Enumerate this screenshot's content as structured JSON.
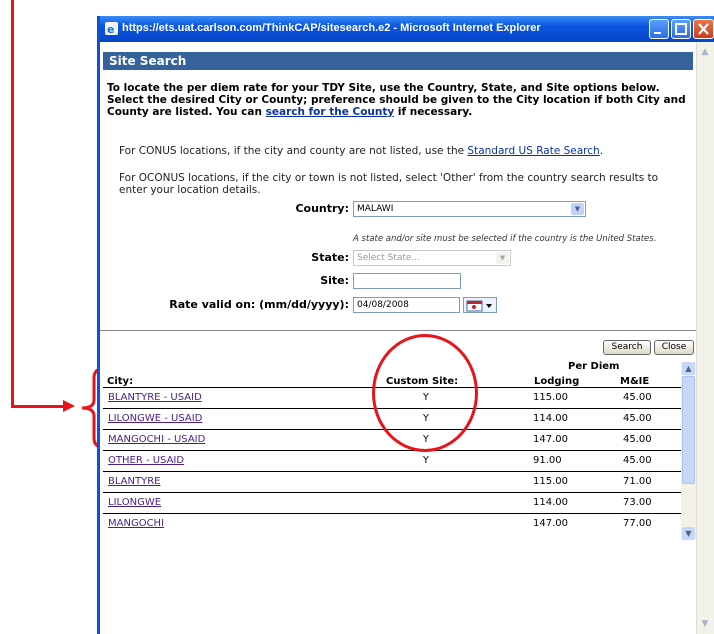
{
  "window": {
    "title": "https://ets.uat.carlson.com/ThinkCAP/sitesearch.e2 - Microsoft Internet Explorer"
  },
  "page": {
    "header": "Site Search",
    "intro": {
      "text_before_link": "To locate the per diem rate for your TDY Site, use the Country, State, and Site options below. Select the desired City or County; preference should be given to the City location if both City and County are listed. You can ",
      "link": "search for the County",
      "text_after_link": " if necessary."
    },
    "conus_note": {
      "text_before_link": "For CONUS locations, if the city and county are not listed, use the ",
      "link": "Standard US Rate Search",
      "text_after_link": "."
    },
    "oconus_note": "For OCONUS locations, if the city or town is not listed, select 'Other' from the country search results to enter your location details.",
    "form": {
      "country_label": "Country:",
      "country_value": "MALAWI",
      "country_hint": "A state and/or site must be selected if the country is the United States.",
      "state_label": "State:",
      "state_placeholder": "Select State...",
      "site_label": "Site:",
      "site_value": "",
      "date_label": "Rate valid on: (mm/dd/yyyy):",
      "date_value": "04/08/2008"
    },
    "buttons": {
      "search": "Search",
      "close": "Close"
    },
    "table": {
      "group_header": "Per Diem",
      "headers": {
        "city": "City:",
        "custom": "Custom Site:",
        "lodging": "Lodging",
        "mie": "M&IE"
      },
      "rows": [
        {
          "city": "BLANTYRE - USAID",
          "custom": "Y",
          "lodging": "115.00",
          "mie": "45.00"
        },
        {
          "city": "LILONGWE - USAID",
          "custom": "Y",
          "lodging": "114.00",
          "mie": "45.00"
        },
        {
          "city": "MANGOCHI - USAID",
          "custom": "Y",
          "lodging": "147.00",
          "mie": "45.00"
        },
        {
          "city": "OTHER - USAID",
          "custom": "Y",
          "lodging": "91.00",
          "mie": "45.00"
        },
        {
          "city": "BLANTYRE",
          "custom": "",
          "lodging": "115.00",
          "mie": "71.00"
        },
        {
          "city": "LILONGWE",
          "custom": "",
          "lodging": "114.00",
          "mie": "73.00"
        },
        {
          "city": "MANGOCHI",
          "custom": "",
          "lodging": "147.00",
          "mie": "77.00"
        }
      ]
    }
  },
  "colors": {
    "annotation": "#e8141b",
    "header_bg": "#36629c",
    "titlebar": "#0a55e0",
    "link": "#0b32a5",
    "visited_link": "#4b1d88"
  },
  "icons": [
    "ie-icon",
    "minimize-icon",
    "maximize-icon",
    "close-icon",
    "chevron-down-icon",
    "calendar-icon",
    "scroll-up-icon",
    "scroll-down-icon"
  ]
}
